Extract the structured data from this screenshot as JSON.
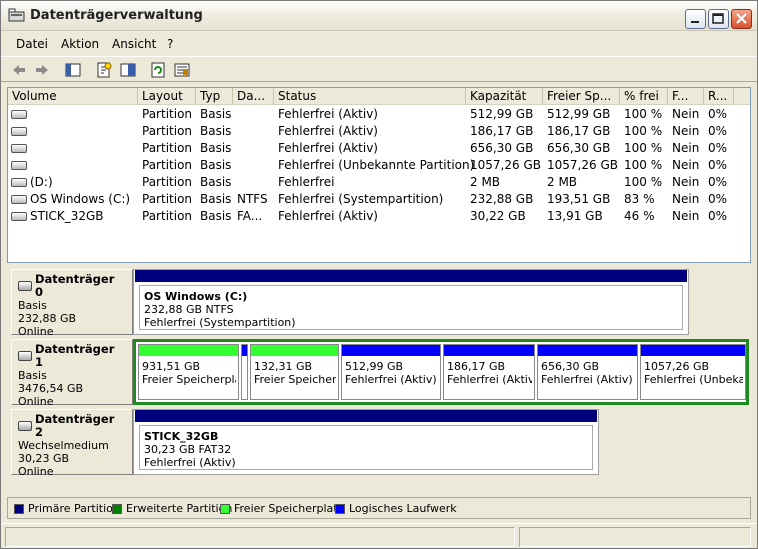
{
  "window": {
    "title": "Datenträgerverwaltung"
  },
  "menu": [
    "Datei",
    "Aktion",
    "Ansicht",
    "?"
  ],
  "toolbar_icons": [
    "back-icon",
    "forward-icon",
    "view-pane-icon",
    "properties-icon",
    "help-icon",
    "refresh-icon",
    "settings-icon"
  ],
  "volume_list": {
    "columns": [
      "Volume",
      "Layout",
      "Typ",
      "Da...",
      "Status",
      "Kapazität",
      "Freier Sp...",
      "% frei",
      "F...",
      "R..."
    ],
    "rows": [
      {
        "volume": "",
        "layout": "Partition",
        "typ": "Basis",
        "dateisystem": "",
        "status": "Fehlerfrei (Aktiv)",
        "kapazitaet": "512,99 GB",
        "frei": "512,99 GB",
        "prozent": "100 %",
        "f": "Nein",
        "r": "0%"
      },
      {
        "volume": "",
        "layout": "Partition",
        "typ": "Basis",
        "dateisystem": "",
        "status": "Fehlerfrei (Aktiv)",
        "kapazitaet": "186,17 GB",
        "frei": "186,17 GB",
        "prozent": "100 %",
        "f": "Nein",
        "r": "0%"
      },
      {
        "volume": "",
        "layout": "Partition",
        "typ": "Basis",
        "dateisystem": "",
        "status": "Fehlerfrei (Aktiv)",
        "kapazitaet": "656,30 GB",
        "frei": "656,30 GB",
        "prozent": "100 %",
        "f": "Nein",
        "r": "0%"
      },
      {
        "volume": "",
        "layout": "Partition",
        "typ": "Basis",
        "dateisystem": "",
        "status": "Fehlerfrei (Unbekannte Partition)",
        "kapazitaet": "1057,26 GB",
        "frei": "1057,26 GB",
        "prozent": "100 %",
        "f": "Nein",
        "r": "0%"
      },
      {
        "volume": "(D:)",
        "layout": "Partition",
        "typ": "Basis",
        "dateisystem": "",
        "status": "Fehlerfrei",
        "kapazitaet": "2 MB",
        "frei": "2 MB",
        "prozent": "100 %",
        "f": "Nein",
        "r": "0%"
      },
      {
        "volume": "OS Windows (C:)",
        "layout": "Partition",
        "typ": "Basis",
        "dateisystem": "NTFS",
        "status": "Fehlerfrei (Systempartition)",
        "kapazitaet": "232,88 GB",
        "frei": "193,51 GB",
        "prozent": "83 %",
        "f": "Nein",
        "r": "0%"
      },
      {
        "volume": "STICK_32GB",
        "layout": "Partition",
        "typ": "Basis",
        "dateisystem": "FA...",
        "status": "Fehlerfrei (Aktiv)",
        "kapazitaet": "30,22 GB",
        "frei": "13,91 GB",
        "prozent": "46 %",
        "f": "Nein",
        "r": "0%"
      }
    ]
  },
  "disks": [
    {
      "name": "Datenträger 0",
      "type": "Basis",
      "size": "232,88 GB",
      "state": "Online",
      "partitions": [
        {
          "title": "OS Windows  (C:)",
          "size": "232,88 GB NTFS",
          "status": "Fehlerfrei (Systempartition)"
        }
      ]
    },
    {
      "name": "Datenträger 1",
      "type": "Basis",
      "size": "3476,54 GB",
      "state": "Online",
      "partitions": [
        {
          "size": "931,51 GB",
          "status": "Freier Speicherplatz"
        },
        {
          "size": "",
          "status": ""
        },
        {
          "size": "132,31 GB",
          "status": "Freier Speicherplatz"
        },
        {
          "size": "512,99 GB",
          "status": "Fehlerfrei (Aktiv)"
        },
        {
          "size": "186,17 GB",
          "status": "Fehlerfrei (Aktiv)"
        },
        {
          "size": "656,30 GB",
          "status": "Fehlerfrei (Aktiv)"
        },
        {
          "size": "1057,26 GB",
          "status": "Fehlerfrei (Unbekannte Partition)"
        }
      ]
    },
    {
      "name": "Datenträger 2",
      "type": "Wechselmedium",
      "size": "30,23 GB",
      "state": "Online",
      "partitions": [
        {
          "title": "STICK_32GB",
          "size": "30,23 GB FAT32",
          "status": "Fehlerfrei (Aktiv)"
        }
      ]
    }
  ],
  "legend": [
    {
      "label": "Primäre Partition",
      "color": "#00007f"
    },
    {
      "label": "Erweiterte Partition",
      "color": "#007f00"
    },
    {
      "label": "Freier Speicherplatz",
      "color": "#33ff33"
    },
    {
      "label": "Logisches Laufwerk",
      "color": "#0000ff"
    }
  ]
}
